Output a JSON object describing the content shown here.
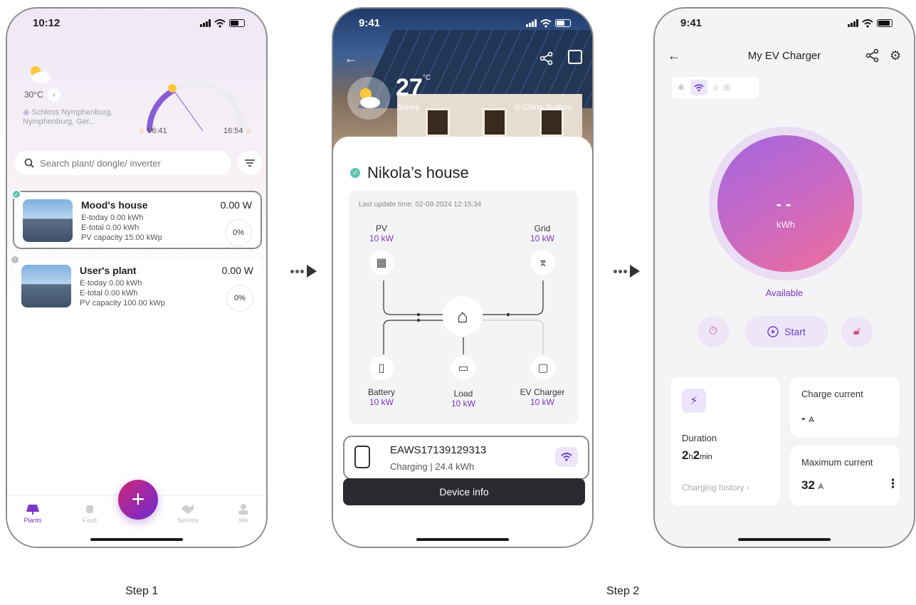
{
  "phone1": {
    "time": "10:12",
    "temperature": "30°C",
    "temp_chevron": "›",
    "location": "Schloss Nymphenburg, Nymphenburg, Ger...",
    "sunrise": "06:41",
    "sunset": "16:54",
    "search_placeholder": "Search plant/ dongle/ inverter",
    "plants": [
      {
        "name": "Mood's house",
        "power": "0.00 W",
        "today": "E-today 0.00 kWh",
        "total": "E-total 0.00 kWh",
        "capacity": "PV capacity 15.00 kWp",
        "percent": "0%"
      },
      {
        "name": "User's plant",
        "power": "0.00 W",
        "today": "E-today 0.00 kWh",
        "total": "E-total 0.00 kWh",
        "capacity": "PV capacity 100.00 kWp",
        "percent": "0%"
      }
    ],
    "tabs": [
      "Plants",
      "Fault",
      "Service",
      "Me"
    ],
    "fab": "+"
  },
  "phone2": {
    "time": "9:41",
    "temperature": "27",
    "unit": "°C",
    "condition": "Sunny",
    "location": "China,Suzhou",
    "plant_name": "Nikola’s house",
    "last_update": "Last update time: 02-09-2024 12:15:34",
    "nodes": {
      "pv": {
        "label": "PV",
        "value": "10 kW"
      },
      "grid": {
        "label": "Grid",
        "value": "10 kW"
      },
      "battery": {
        "label": "Battery",
        "value": "10 kW"
      },
      "load": {
        "label": "Load",
        "value": "10 kW"
      },
      "ev": {
        "label": "EV Charger",
        "value": "10 kW"
      }
    },
    "device_id": "EAWS17139129313",
    "device_status": "Charging | 24.4 kWh",
    "device_button": "Device info"
  },
  "phone3": {
    "time": "9:41",
    "title": "My EV Charger",
    "dial_value": "--",
    "dial_unit": "kWh",
    "status": "Available",
    "start": "Start",
    "duration_label": "Duration",
    "duration_h": "2",
    "duration_h_unit": "h",
    "duration_m": "2",
    "duration_m_unit": "min",
    "history": "Charging history",
    "history_chevron": "›",
    "charge_current_label": "Charge current",
    "charge_current_value": "-",
    "charge_current_unit": "A",
    "max_current_label": "Maximum current",
    "max_current_value": "32",
    "max_current_unit": "A",
    "more": "⋮"
  },
  "steps": [
    "Step 1",
    "Step 2"
  ],
  "colors": {
    "accent": "#7b35c8",
    "ok": "#5ec4b0"
  }
}
